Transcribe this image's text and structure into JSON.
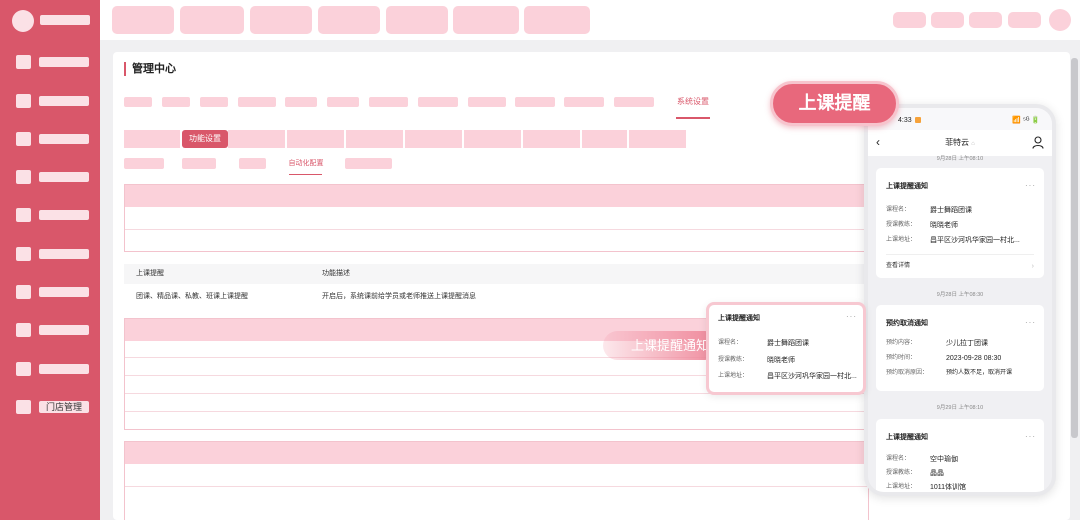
{
  "sidebar": {
    "items": [
      {
        "icon": "menu-icon"
      },
      {
        "icon": "menu-icon"
      },
      {
        "icon": "menu-icon"
      },
      {
        "icon": "menu-icon"
      },
      {
        "icon": "menu-icon"
      },
      {
        "icon": "menu-icon"
      },
      {
        "icon": "menu-icon"
      },
      {
        "icon": "menu-icon"
      },
      {
        "icon": "menu-icon"
      },
      {
        "icon": "menu-icon"
      }
    ],
    "store_label": "门店管理"
  },
  "page": {
    "title": "管理中心",
    "active_nav": "系统设置",
    "active_subtab": "功能设置",
    "active_subtab2": "自动化配置"
  },
  "table": {
    "headers": [
      "上课提醒",
      "功能描述"
    ],
    "row": [
      "团课、精品课、私教、班课上课提醒",
      "开启后，系统课前给学员或老师推送上课提醒消息"
    ]
  },
  "callouts": {
    "big": "上课提醒",
    "soft": "上课提醒通知"
  },
  "float_card": {
    "title": "上课提醒通知",
    "more": "···",
    "rows": [
      {
        "k": "课程名：",
        "v": "爵士舞蹈团课"
      },
      {
        "k": "授课教练：",
        "v": "晓晓老师"
      },
      {
        "k": "上课地址：",
        "v": "昌平区沙河巩华家园一村北..."
      }
    ]
  },
  "phone": {
    "time": "4:33",
    "signal": "📶 ⁵ᴳ 🔋",
    "back": "‹",
    "title": "菲特云",
    "title_suffix": "⌂",
    "cards": [
      {
        "time_label": "9月28日 上午08:10",
        "title": "上课提醒通知",
        "rows": [
          {
            "k": "课程名：",
            "v": "爵士舞蹈团课"
          },
          {
            "k": "授课教练：",
            "v": "晓晓老师"
          },
          {
            "k": "上课地址：",
            "v": "昌平区沙河巩华家园一村北..."
          }
        ],
        "link": "查看详情"
      },
      {
        "time_label": "9月28日 上午08:30",
        "title": "预约取消通知",
        "rows": [
          {
            "k": "预约内容：",
            "v": "少儿拉丁团课"
          },
          {
            "k": "预约时间：",
            "v": "2023-09-28 08:30"
          },
          {
            "k": "预约取消原因：",
            "v": "预约人数不足，取消开课"
          }
        ]
      },
      {
        "time_label": "9月29日 上午08:10",
        "title": "上课提醒通知",
        "rows": [
          {
            "k": "课程名：",
            "v": "空中瑜伽"
          },
          {
            "k": "授课教练：",
            "v": "晶晶"
          },
          {
            "k": "上课地址：",
            "v": "1011体训馆"
          }
        ]
      }
    ]
  },
  "colors": {
    "accent": "#d9576a",
    "pink_light": "#fbd1da",
    "callout": "#e8687c"
  }
}
